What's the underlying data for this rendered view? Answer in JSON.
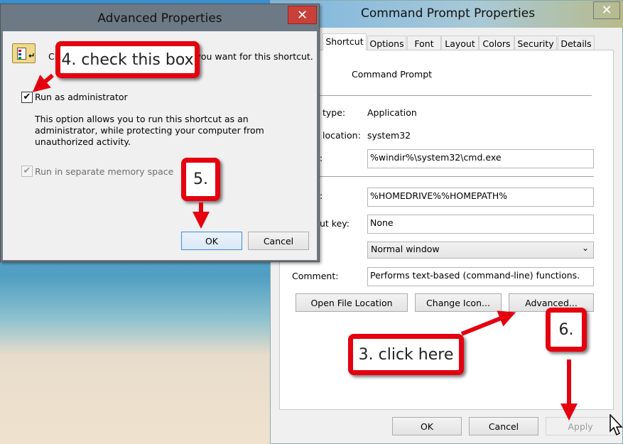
{
  "main_window": {
    "title": "Command Prompt Properties",
    "tabs": [
      {
        "label": "Shortcut",
        "active": true
      },
      {
        "label": "Options"
      },
      {
        "label": "Font"
      },
      {
        "label": "Layout"
      },
      {
        "label": "Colors"
      },
      {
        "label": "Security"
      },
      {
        "label": "Details"
      }
    ],
    "shortcut_name": "Command Prompt",
    "target_type_label": "type:",
    "target_type_value": "Application",
    "target_location_label": "location:",
    "target_location_value": "system32",
    "target_label": ":",
    "target_value": "%windir%\\system32\\cmd.exe",
    "start_in_label": ":",
    "start_in_value": "%HOMEDRIVE%%HOMEPATH%",
    "shortcut_key_label": "ut key:",
    "shortcut_key_value": "None",
    "run_value": "Normal window",
    "comment_label": "Comment:",
    "comment_value": "Performs text-based (command-line) functions.",
    "buttons": {
      "open_file_location": "Open File Location",
      "change_icon": "Change Icon...",
      "advanced": "Advanced...",
      "ok": "OK",
      "cancel": "Cancel",
      "apply": "Apply"
    }
  },
  "advanced_dialog": {
    "title": "Advanced Properties",
    "intro": "Choose the advanced properties you want for this shortcut.",
    "run_as_admin_label": "Run as administrator",
    "run_as_admin_checked": true,
    "description": [
      "This option allows you to run this shortcut as an",
      "administrator, while protecting your computer from",
      "unauthorized activity."
    ],
    "separate_memory_label": "Run in separate memory space",
    "separate_memory_checked": true,
    "ok": "OK",
    "cancel": "Cancel"
  },
  "annotations": {
    "step3": "3. click here",
    "step4": "4. check this box",
    "step5": "5.",
    "step6": "6."
  },
  "colors": {
    "callout_red": "#e4000f",
    "close_red": "#c9403a"
  }
}
